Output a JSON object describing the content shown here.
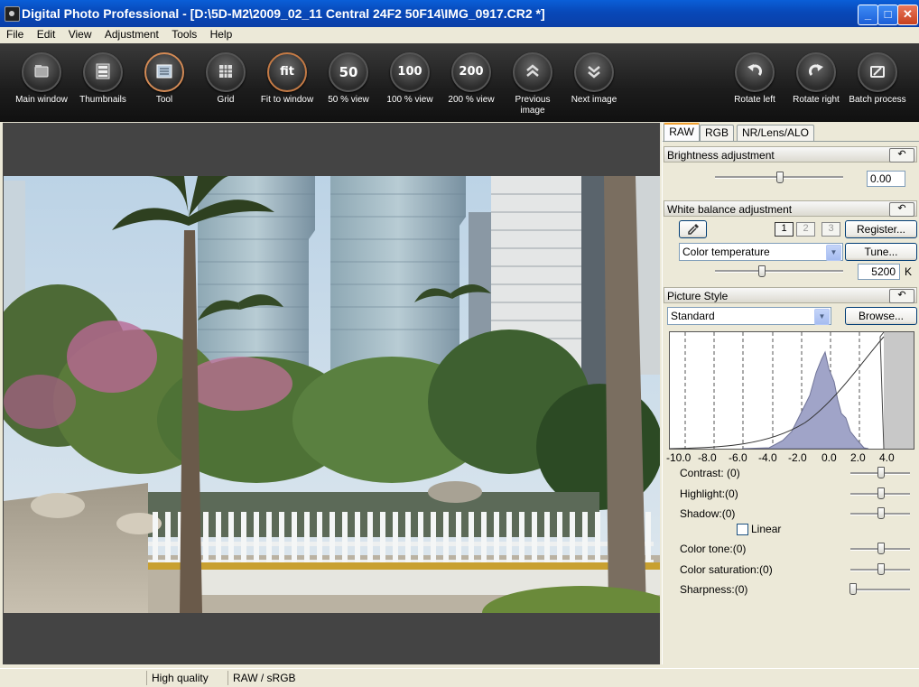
{
  "window": {
    "title": "Digital Photo Professional - [D:\\5D-M2\\2009_02_11 Central 24F2 50F14\\IMG_0917.CR2 *]",
    "minimize_label": "_",
    "maximize_label": "□",
    "close_label": "✕"
  },
  "menu": [
    "File",
    "Edit",
    "View",
    "Adjustment",
    "Tools",
    "Help"
  ],
  "toolbar": {
    "main_window": "Main window",
    "thumbnails": "Thumbnails",
    "tool": "Tool",
    "grid": "Grid",
    "fit": "Fit to window",
    "fit_glyph": "fit",
    "view50": "50 % view",
    "view50_glyph": "50",
    "view100": "100 % view",
    "view100_glyph": "100",
    "view200": "200 % view",
    "view200_glyph": "200",
    "previous": "Previous image",
    "next": "Next image",
    "rotate_left": "Rotate left",
    "rotate_right": "Rotate right",
    "batch": "Batch process"
  },
  "tabs": [
    "RAW",
    "RGB",
    "NR/Lens/ALO"
  ],
  "brightness": {
    "header": "Brightness adjustment",
    "value": "0.00",
    "slider_position": 0.5
  },
  "white_balance": {
    "header": "White balance adjustment",
    "presets": [
      "1",
      "2",
      "3"
    ],
    "register_label": "Register...",
    "mode": "Color temperature",
    "tune_label": "Tune...",
    "temperature": "5200",
    "unit": "K"
  },
  "picture_style": {
    "header": "Picture Style",
    "style": "Standard",
    "browse_label": "Browse...",
    "histogram_axis": [
      "-10.0",
      "-8.0",
      "-6.0",
      "-4.0",
      "-2.0",
      "0.0",
      "2.0",
      "4.0"
    ],
    "params": {
      "contrast": "Contrast: (0)",
      "highlight": "Highlight:(0)",
      "shadow": "Shadow:(0)",
      "linear": "Linear",
      "color_tone": "Color tone:(0)",
      "color_saturation": "Color saturation:(0)",
      "sharpness": "Sharpness:(0)"
    }
  },
  "status": {
    "quality": "High quality",
    "colorspace": "RAW / sRGB"
  },
  "icons": {
    "reset": "↶",
    "dropdown": "▼",
    "eyedropper": "eyedropper-icon"
  }
}
